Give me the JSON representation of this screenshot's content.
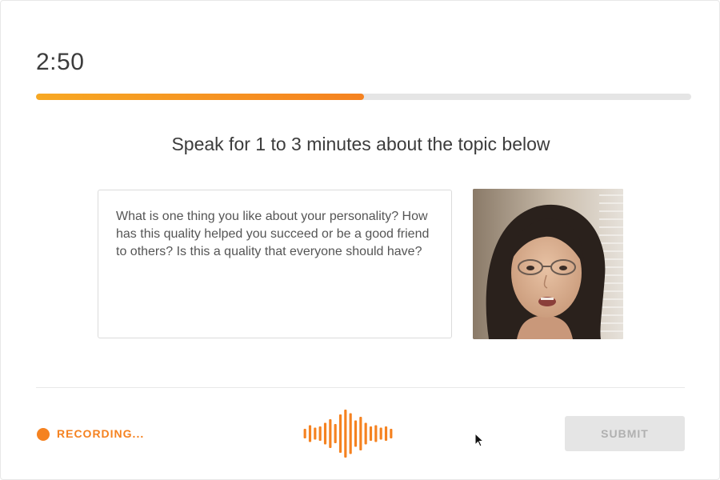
{
  "timer": {
    "remaining": "2:50",
    "progress_fraction": 0.5
  },
  "prompt": {
    "heading": "Speak for 1 to 3 minutes about the topic below",
    "question": "What is one thing you like about your personality? How has this quality helped you succeed or be a good friend to others? Is this a quality that everyone should have?"
  },
  "recording": {
    "status_label": "RECORDING..."
  },
  "actions": {
    "submit_label": "SUBMIT"
  },
  "colors": {
    "accent": "#f58220",
    "accent_light": "#f7a823",
    "track": "#e5e5e5",
    "disabled_button": "#e5e5e5",
    "disabled_text": "#b0b0b0",
    "text": "#3c3c3c"
  },
  "icons": {
    "recording_indicator": "record-dot-icon",
    "audio": "audio-waveform-icon",
    "pointer": "mouse-cursor-icon"
  },
  "waveform_levels": [
    0.2,
    0.35,
    0.25,
    0.3,
    0.45,
    0.6,
    0.4,
    0.8,
    1.0,
    0.85,
    0.55,
    0.7,
    0.45,
    0.3,
    0.35,
    0.25,
    0.3,
    0.2
  ]
}
